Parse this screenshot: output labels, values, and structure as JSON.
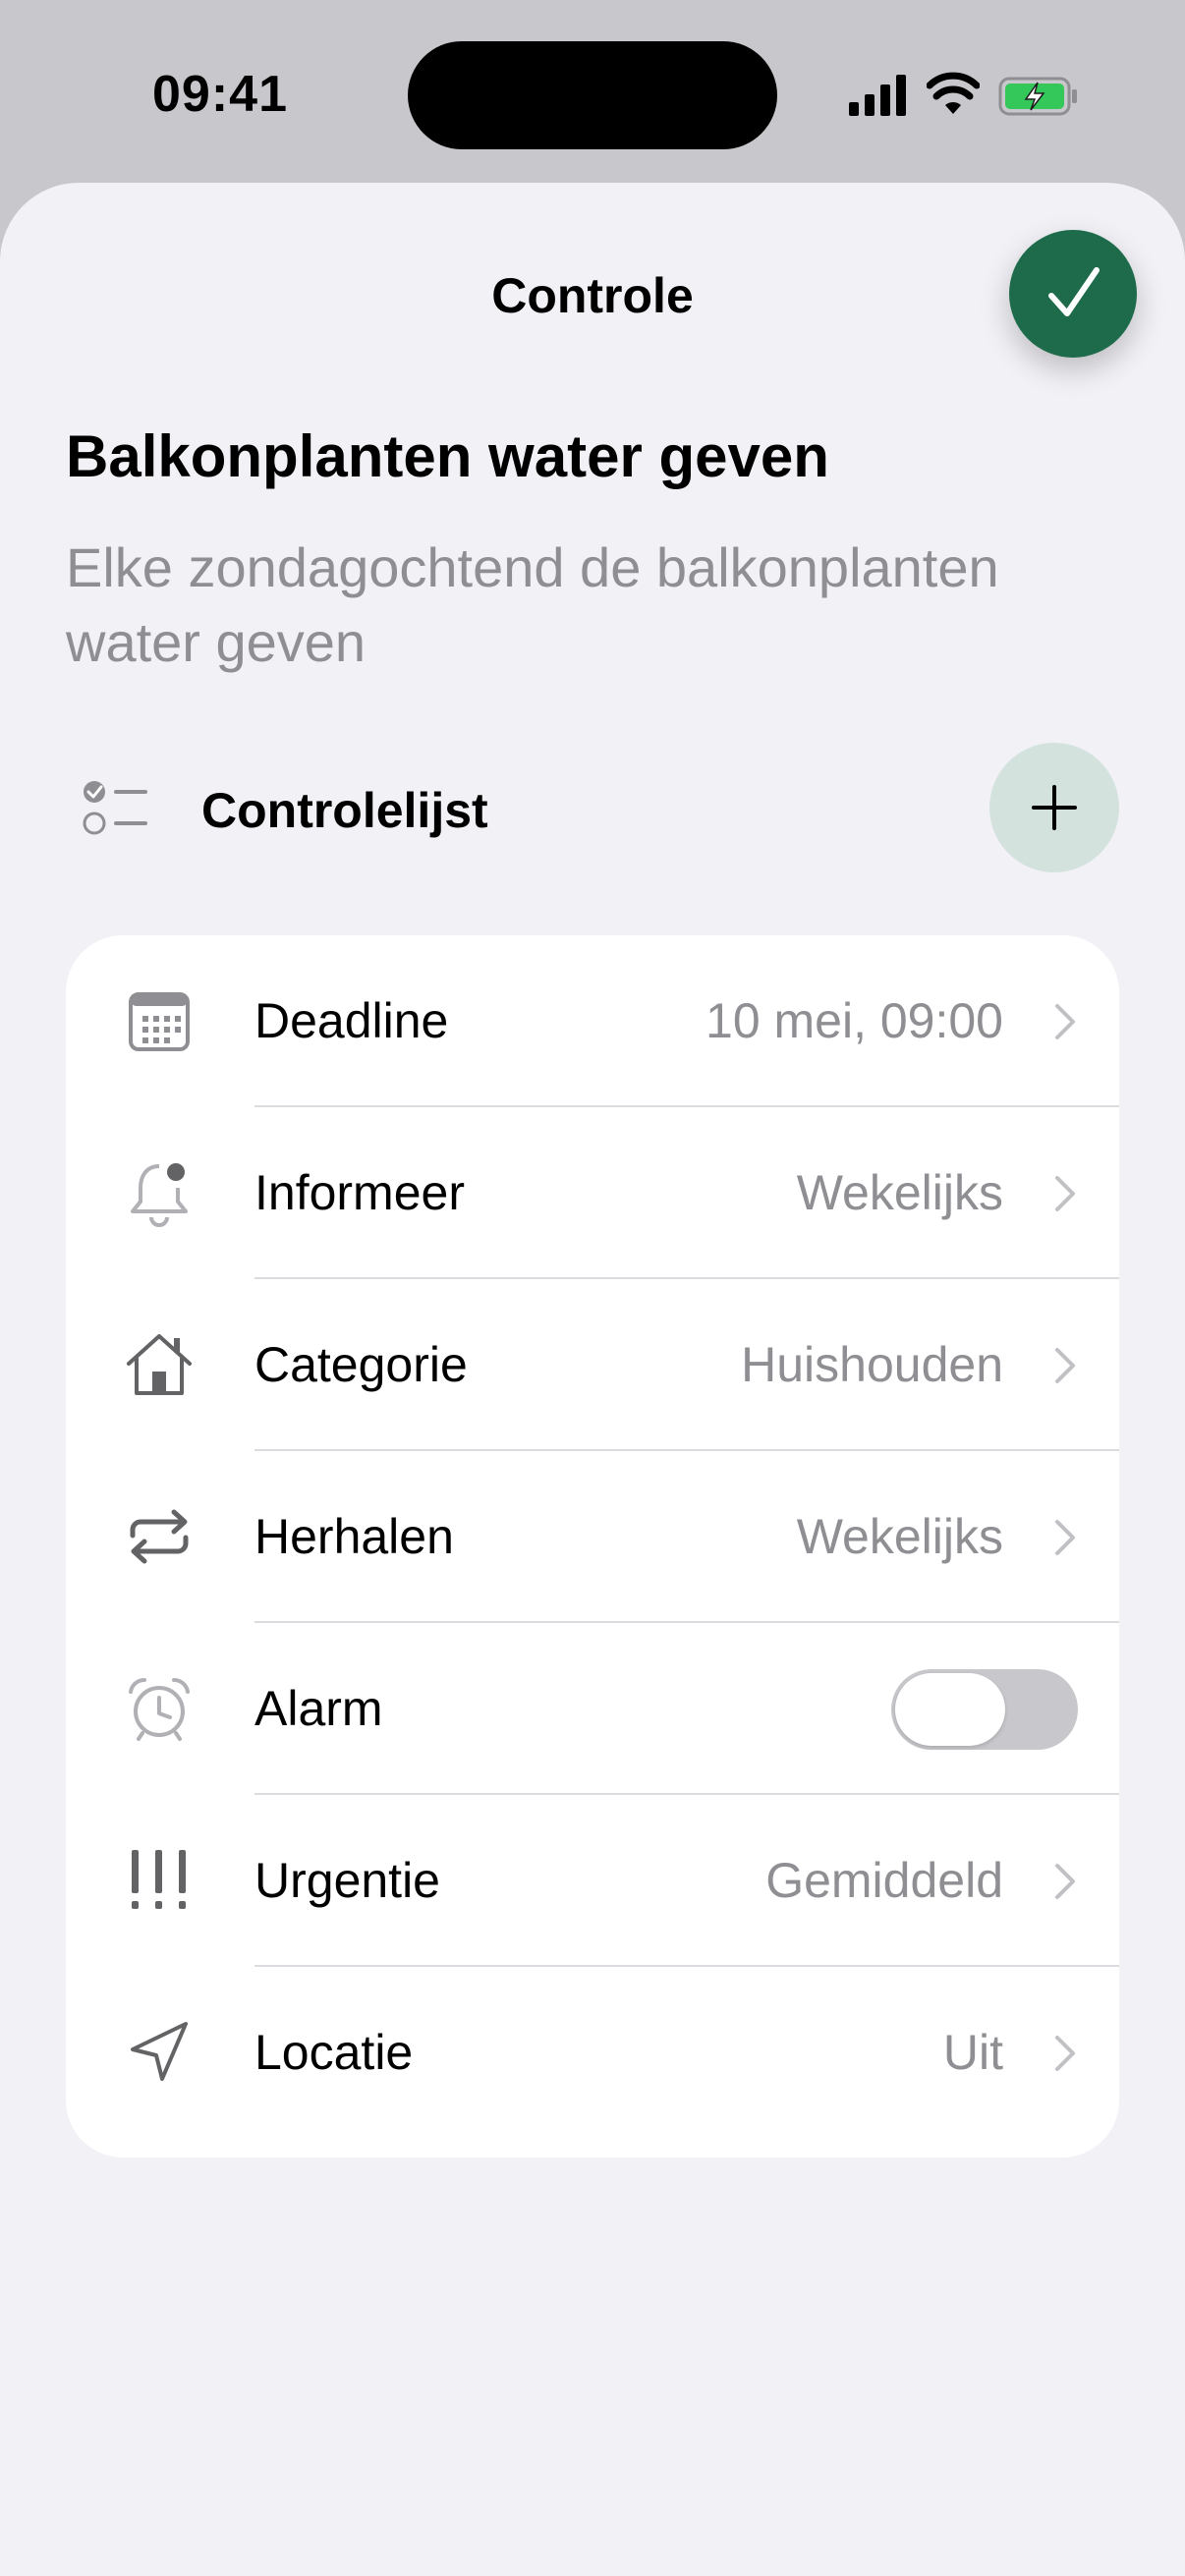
{
  "status_bar": {
    "time": "09:41"
  },
  "sheet": {
    "title": "Controle",
    "done_icon": "checkmark-icon",
    "accent_color": "#1d6b4a"
  },
  "task": {
    "title": "Balkonplanten water geven",
    "description": "Elke zondagochtend de balkonplanten water geven"
  },
  "checklist": {
    "label": "Controlelijst",
    "add_icon": "plus-icon"
  },
  "settings": [
    {
      "icon": "calendar-icon",
      "label": "Deadline",
      "value": "10 mei, 09:00"
    },
    {
      "icon": "bell-badge-icon",
      "label": "Informeer",
      "value": "Wekelijks"
    },
    {
      "icon": "house-icon",
      "label": "Categorie",
      "value": "Huishouden"
    },
    {
      "icon": "repeat-icon",
      "label": "Herhalen",
      "value": "Wekelijks"
    },
    {
      "icon": "alarm-clock-icon",
      "label": "Alarm",
      "toggle_on": false
    },
    {
      "icon": "exclamation-icon",
      "label": "Urgentie",
      "value": "Gemiddeld"
    },
    {
      "icon": "location-arrow-icon",
      "label": "Locatie",
      "value": "Uit"
    }
  ]
}
